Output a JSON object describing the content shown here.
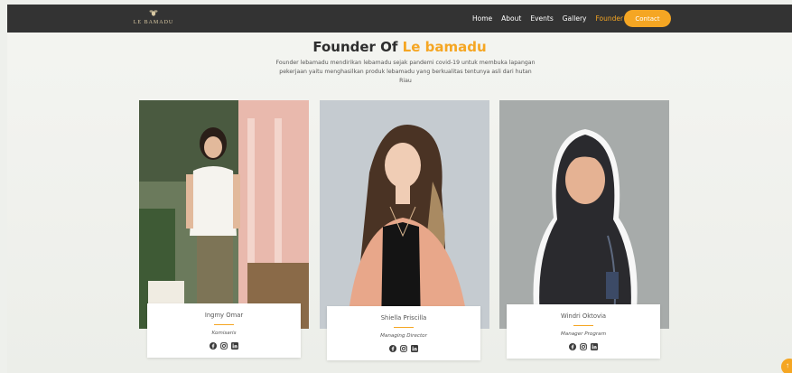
{
  "brand": {
    "name": "LE BAMADU"
  },
  "nav": {
    "items": [
      {
        "label": "Home",
        "active": false
      },
      {
        "label": "About",
        "active": false
      },
      {
        "label": "Events",
        "active": false
      },
      {
        "label": "Gallery",
        "active": false
      },
      {
        "label": "Founder",
        "active": true
      }
    ],
    "contact_label": "Contact"
  },
  "hero": {
    "title_main": "Founder Of ",
    "title_accent": "Le bamadu",
    "description": "Founder lebamadu mendirikan lebamadu sejak pandemi covid-19 untuk membuka lapangan pekerjaan yaitu menghasilkan produk lebamadu yang berkualitas tentunya asli dari hutan Riau"
  },
  "founders": [
    {
      "name": "Ingmy Omar",
      "role": "Komisaris",
      "socials": [
        "facebook-icon",
        "instagram-icon",
        "linkedin-icon"
      ]
    },
    {
      "name": "Shiella Priscilla",
      "role": "Managing Director",
      "socials": [
        "facebook-icon",
        "instagram-icon",
        "linkedin-icon"
      ]
    },
    {
      "name": "Windri Oktovia",
      "role": "Manager Program",
      "socials": [
        "facebook-icon",
        "instagram-icon",
        "linkedin-icon"
      ]
    }
  ],
  "colors": {
    "accent": "#f5a623",
    "navbar": "#333333",
    "text": "#2e2e2e"
  },
  "scroll_top_icon": "arrow-up-icon"
}
